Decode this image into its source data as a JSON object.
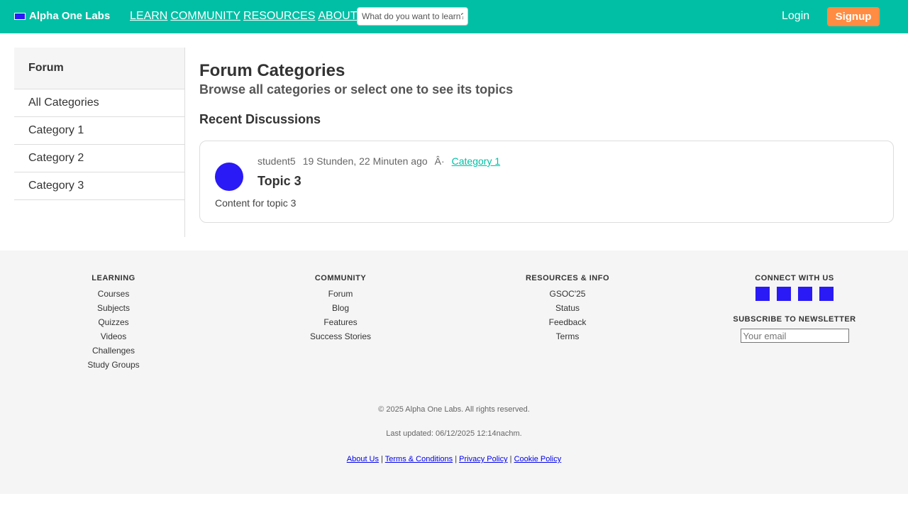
{
  "header": {
    "brand": "Alpha One Labs",
    "nav": [
      "LEARN",
      "COMMUNITY",
      "RESOURCES",
      "ABOUT"
    ],
    "search_placeholder": "What do you want to learn?",
    "login": "Login",
    "signup": "Signup",
    "colors": {
      "bar": "#00bfa5",
      "signup": "#ff8c42"
    }
  },
  "sidebar": {
    "title": "Forum",
    "items": [
      "All Categories",
      "Category 1",
      "Category 2",
      "Category 3"
    ]
  },
  "main": {
    "title": "Forum Categories",
    "subtitle": "Browse all categories or select one to see its topics",
    "section": "Recent Discussions",
    "topic": {
      "author": "student5",
      "time": "19 Stunden, 22 Minuten ago",
      "separator": "Â·",
      "category": "Category 1",
      "title": "Topic 3",
      "content": "Content for topic 3"
    }
  },
  "footer": {
    "learning": {
      "title": "LEARNING",
      "items": [
        "Courses",
        "Subjects",
        "Quizzes",
        "Videos",
        "Challenges",
        "Study Groups"
      ]
    },
    "community": {
      "title": "COMMUNITY",
      "items": [
        "Forum",
        "Blog",
        "Features",
        "Success Stories"
      ]
    },
    "resources": {
      "title": "RESOURCES & INFO",
      "items": [
        "GSOC'25",
        "Status",
        "Feedback",
        "Terms"
      ]
    },
    "connect": {
      "title": "CONNECT WITH US",
      "newsletter_title": "SUBSCRIBE TO NEWSLETTER",
      "email_placeholder": "Your email"
    },
    "copyright": "© 2025 Alpha One Labs. All rights reserved.",
    "updated": "Last updated: 06/12/2025 12:14nachm.",
    "legal": [
      "About Us",
      "Terms & Conditions",
      "Privacy Policy",
      "Cookie Policy"
    ],
    "legal_separator": "|"
  }
}
